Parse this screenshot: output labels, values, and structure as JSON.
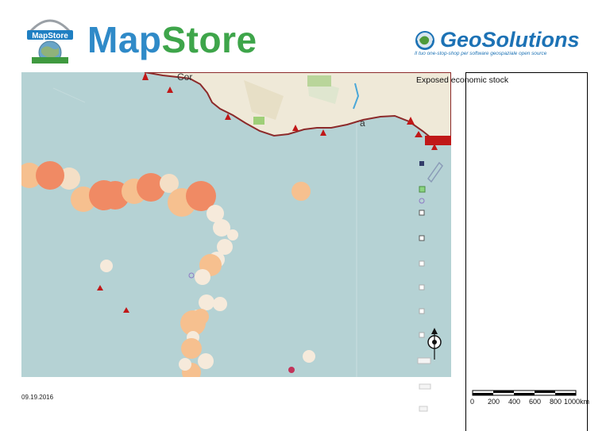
{
  "header": {
    "mapstore_badge_text": "MapStore",
    "mapstore_title_map": "Map",
    "mapstore_title_store": "Store",
    "geosolutions_title": "GeoSolutions",
    "geosolutions_tagline": "Il tuo one-stop-shop per software geospaziale open source"
  },
  "map": {
    "place_label": "Cor",
    "place_label_2": "a",
    "ocean_color": "#b5d2d4",
    "land_color": "#efe9d8",
    "bubble_colors": [
      "#f08a64",
      "#f6c08f",
      "#f4dfc6",
      "#f6eadb"
    ]
  },
  "legend": {
    "title": "Exposed economic stock"
  },
  "footer": {
    "date": "09.19.2016"
  },
  "scale": {
    "labels": [
      "0",
      "200",
      "400",
      "600",
      "800",
      "1000km"
    ]
  }
}
